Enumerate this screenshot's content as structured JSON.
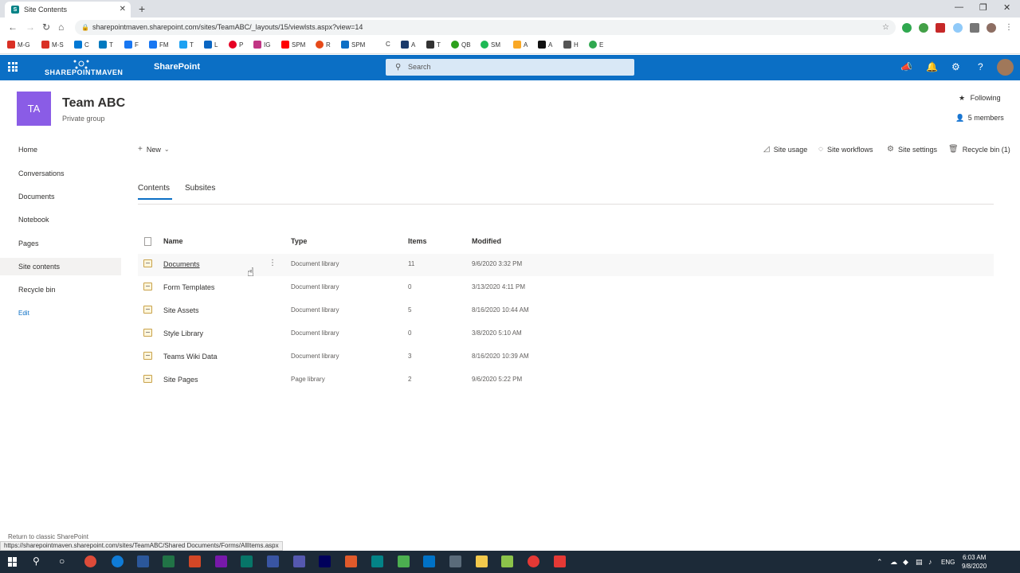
{
  "browser": {
    "tab_title": "Site Contents",
    "url": "sharepointmaven.sharepoint.com/sites/TeamABC/_layouts/15/viewlsts.aspx?view=14",
    "bookmarks": [
      "M-G",
      "M-S",
      "C",
      "T",
      "F",
      "FM",
      "T",
      "L",
      "P",
      "IG",
      "SPM",
      "R",
      "SPM",
      "C",
      "A",
      "T",
      "QB",
      "SM",
      "A",
      "A",
      "H",
      "E"
    ],
    "status_url": "https://sharepointmaven.sharepoint.com/sites/TeamABC/Shared Documents/Forms/AllItems.aspx"
  },
  "suite": {
    "brand": "SHAREPOINTMAVEN",
    "app": "SharePoint",
    "search_placeholder": "Search"
  },
  "site": {
    "logo_initials": "TA",
    "name": "Team ABC",
    "subtitle": "Private group",
    "following": "Following",
    "members": "5 members"
  },
  "leftnav": [
    "Home",
    "Conversations",
    "Documents",
    "Notebook",
    "Pages",
    "Site contents",
    "Recycle bin"
  ],
  "leftnav_edit": "Edit",
  "commands": {
    "new": "New",
    "site_usage": "Site usage",
    "site_workflows": "Site workflows",
    "site_settings": "Site settings",
    "recycle_bin": "Recycle bin (1)"
  },
  "pivots": {
    "contents": "Contents",
    "subsites": "Subsites"
  },
  "table": {
    "headers": {
      "name": "Name",
      "type": "Type",
      "items": "Items",
      "modified": "Modified"
    },
    "rows": [
      {
        "name": "Documents",
        "type": "Document library",
        "items": "11",
        "modified": "9/6/2020 3:32 PM"
      },
      {
        "name": "Form Templates",
        "type": "Document library",
        "items": "0",
        "modified": "3/13/2020 4:11 PM"
      },
      {
        "name": "Site Assets",
        "type": "Document library",
        "items": "5",
        "modified": "8/16/2020 10:44 AM"
      },
      {
        "name": "Style Library",
        "type": "Document library",
        "items": "0",
        "modified": "3/8/2020 5:10 AM"
      },
      {
        "name": "Teams Wiki Data",
        "type": "Document library",
        "items": "3",
        "modified": "8/16/2020 10:39 AM"
      },
      {
        "name": "Site Pages",
        "type": "Page library",
        "items": "2",
        "modified": "9/6/2020 5:22 PM"
      }
    ]
  },
  "footer": {
    "classic": "Return to classic SharePoint"
  },
  "taskbar": {
    "lang": "ENG",
    "time": "6:03 AM",
    "date": "9/8/2020"
  }
}
